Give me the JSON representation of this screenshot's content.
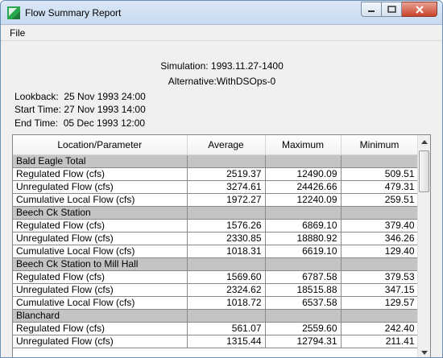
{
  "window": {
    "title": "Flow Summary Report",
    "accent_color": "#c9432c"
  },
  "menu": {
    "file_label": "File"
  },
  "report": {
    "simulation": "Simulation:  1993.11.27-1400",
    "alternative": "Alternative:WithDSOps-0",
    "lookback": "Lookback:  25 Nov 1993 24:00",
    "start_time": "Start Time: 27 Nov 1993 14:00",
    "end_time": "End Time:  05 Dec 1993 12:00"
  },
  "table": {
    "columns": [
      "Location/Parameter",
      "Average",
      "Maximum",
      "Minimum"
    ],
    "rows": [
      {
        "type": "group",
        "label": "Bald Eagle Total"
      },
      {
        "type": "data",
        "label": "Regulated Flow (cfs)",
        "average": "2519.37",
        "maximum": "12490.09",
        "minimum": "509.51"
      },
      {
        "type": "data",
        "label": "Unregulated Flow (cfs)",
        "average": "3274.61",
        "maximum": "24426.66",
        "minimum": "479.31"
      },
      {
        "type": "data",
        "label": "Cumulative Local Flow (cfs)",
        "average": "1972.27",
        "maximum": "12240.09",
        "minimum": "259.51"
      },
      {
        "type": "group",
        "label": "Beech Ck Station"
      },
      {
        "type": "data",
        "label": "Regulated Flow (cfs)",
        "average": "1576.26",
        "maximum": "6869.10",
        "minimum": "379.40"
      },
      {
        "type": "data",
        "label": "Unregulated Flow (cfs)",
        "average": "2330.85",
        "maximum": "18880.92",
        "minimum": "346.26"
      },
      {
        "type": "data",
        "label": "Cumulative Local Flow (cfs)",
        "average": "1018.31",
        "maximum": "6619.10",
        "minimum": "129.40"
      },
      {
        "type": "group",
        "label": "Beech Ck Station to Mill Hall"
      },
      {
        "type": "data",
        "label": "Regulated Flow (cfs)",
        "average": "1569.60",
        "maximum": "6787.58",
        "minimum": "379.53"
      },
      {
        "type": "data",
        "label": "Unregulated Flow (cfs)",
        "average": "2324.62",
        "maximum": "18515.88",
        "minimum": "347.15"
      },
      {
        "type": "data",
        "label": "Cumulative Local Flow (cfs)",
        "average": "1018.72",
        "maximum": "6537.58",
        "minimum": "129.57"
      },
      {
        "type": "group",
        "label": "Blanchard"
      },
      {
        "type": "data",
        "label": "Regulated Flow (cfs)",
        "average": "561.07",
        "maximum": "2559.60",
        "minimum": "242.40"
      },
      {
        "type": "data",
        "label": "Unregulated Flow (cfs)",
        "average": "1315.44",
        "maximum": "12794.31",
        "minimum": "211.41"
      }
    ]
  },
  "icons": {
    "app": "app-icon",
    "minimize": "minimize-icon",
    "maximize": "maximize-icon",
    "close": "close-icon",
    "scroll_up": "scroll-up-icon",
    "scroll_down": "scroll-down-icon"
  }
}
